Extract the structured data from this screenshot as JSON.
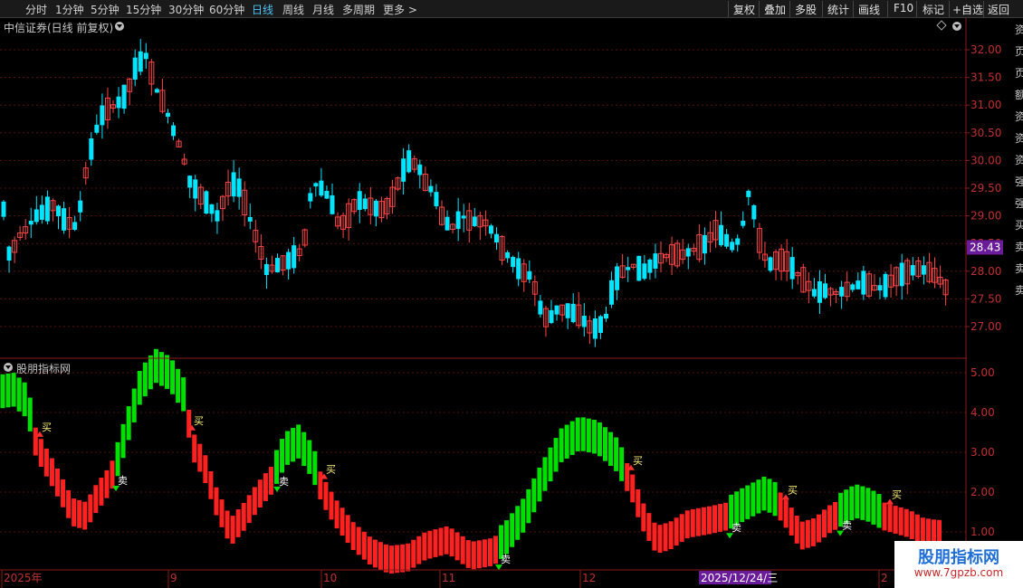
{
  "toolbar": {
    "left": [
      "分时",
      "1分钟",
      "5分钟",
      "15分钟",
      "30分钟",
      "60分钟",
      "日线",
      "周线",
      "月线",
      "多周期",
      "更多 >"
    ],
    "active_index": 6,
    "right": [
      "复权",
      "叠加",
      "多股",
      "统计",
      "画线",
      "F10",
      "标记",
      "+自选",
      "返回"
    ]
  },
  "main_title": "中信证券(日线 前复权)",
  "indicator_title": "股朋指标网",
  "price_axis": [
    "32.00",
    "31.50",
    "31.00",
    "30.50",
    "30.00",
    "29.50",
    "29.00",
    "28.50",
    "28.00",
    "27.50",
    "27.00"
  ],
  "current_price": "28.43",
  "indicator_axis": [
    "5.00",
    "4.00",
    "3.00",
    "2.00",
    "1.00"
  ],
  "date_labels": [
    "2025年",
    "9",
    "10",
    "11",
    "12",
    "2"
  ],
  "cursor_date": "2025/12/24/三",
  "buy_label": "买",
  "sell_label": "卖",
  "watermark": {
    "name": "股朋指标网",
    "url": "www.7gpzb.com"
  },
  "right_edge_chars": [
    "资",
    "页",
    "页",
    "额",
    "资",
    "资",
    "资",
    "强",
    "强",
    "买",
    "卖",
    "卖",
    "卖"
  ],
  "colors": {
    "up": "#ff4444",
    "down": "#00e5ff",
    "green": "#00e000",
    "red": "#ff2020",
    "grid": "#5a1010",
    "axis": "#8b1a1a",
    "price_tag": "#6a1b9a"
  }
}
